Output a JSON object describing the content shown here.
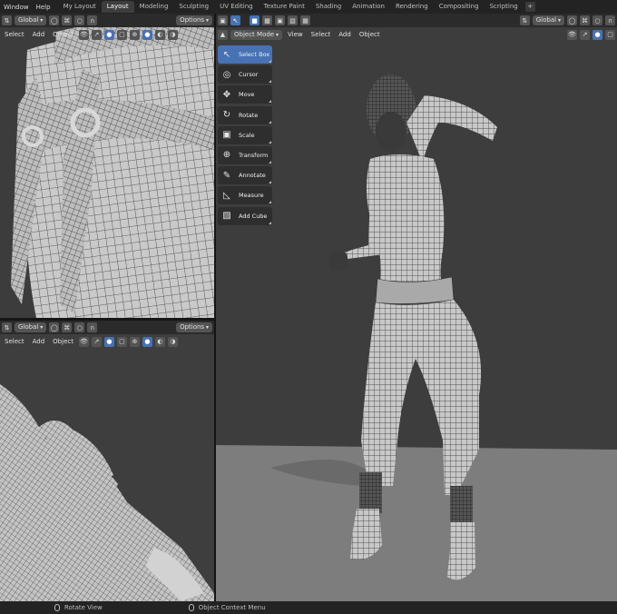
{
  "topbar": {
    "menus": [
      "Window",
      "Help"
    ],
    "tabs": [
      "My Layout",
      "Layout",
      "Modeling",
      "Sculpting",
      "UV Editing",
      "Texture Paint",
      "Shading",
      "Animation",
      "Rendering",
      "Compositing",
      "Scripting"
    ],
    "active_tab": "Layout",
    "add_tab": "+"
  },
  "left_top_viewport": {
    "orientation": "Global",
    "options": "Options",
    "menus": [
      "Select",
      "Add",
      "Object"
    ]
  },
  "left_bottom_viewport": {
    "orientation": "Global",
    "options": "Options",
    "menus": [
      "Select",
      "Add",
      "Object"
    ]
  },
  "main_viewport": {
    "orientation": "Global",
    "mode": "Object Mode",
    "menus": [
      "View",
      "Select",
      "Add",
      "Object"
    ]
  },
  "tools": [
    {
      "label": "Select Box",
      "icon": "select-box-icon",
      "glyph": "↖"
    },
    {
      "label": "Cursor",
      "icon": "cursor-icon",
      "glyph": "◎"
    },
    {
      "label": "Move",
      "icon": "move-icon",
      "glyph": "✥"
    },
    {
      "label": "Rotate",
      "icon": "rotate-icon",
      "glyph": "↻"
    },
    {
      "label": "Scale",
      "icon": "scale-icon",
      "glyph": "▣"
    },
    {
      "label": "Transform",
      "icon": "transform-icon",
      "glyph": "⊕"
    },
    {
      "label": "Annotate",
      "icon": "annotate-icon",
      "glyph": "✎"
    },
    {
      "label": "Measure",
      "icon": "measure-icon",
      "glyph": "◺"
    },
    {
      "label": "Add Cube",
      "icon": "add-cube-icon",
      "glyph": "▧"
    }
  ],
  "active_tool": "Select Box",
  "statusbar": {
    "left_hint": "Rotate View",
    "right_hint": "Object Context Menu"
  },
  "colors": {
    "accent": "#4772b3",
    "header": "#2b2b2b",
    "viewport_bg": "#3d3d3d",
    "floor": "#7d7d7d"
  }
}
